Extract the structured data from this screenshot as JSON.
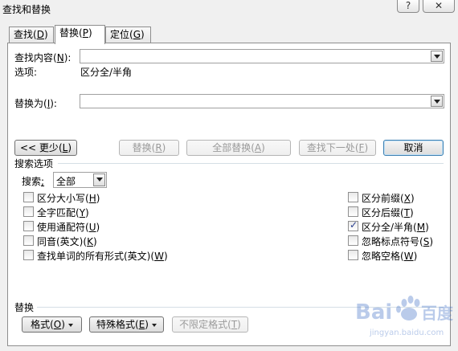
{
  "window": {
    "title": "查找和替换",
    "help_label": "?",
    "close_label": "✕"
  },
  "tabs": [
    {
      "label": "查找",
      "key": "D",
      "active": false
    },
    {
      "label": "替换",
      "key": "P",
      "active": true
    },
    {
      "label": "定位",
      "key": "G",
      "active": false
    }
  ],
  "find": {
    "label": "查找内容",
    "key": "N",
    "value": ""
  },
  "options": {
    "label": "选项:",
    "value": "区分全/半角"
  },
  "replace": {
    "label": "替换为",
    "key": "I",
    "value": ""
  },
  "buttons": {
    "less": {
      "label": "<< 更少",
      "key": "L"
    },
    "replace": {
      "label": "替换",
      "key": "R"
    },
    "replace_all": {
      "label": "全部替换",
      "key": "A"
    },
    "find_next": {
      "label": "查找下一处",
      "key": "F"
    },
    "cancel": {
      "label": "取消"
    }
  },
  "search_options": {
    "heading": "搜索选项",
    "search_label": "搜索",
    "search_key": ";",
    "search_value": "全部"
  },
  "left_checkboxes": [
    {
      "label": "区分大小写",
      "key": "H",
      "checked": false
    },
    {
      "label": "全字匹配",
      "key": "Y",
      "checked": false
    },
    {
      "label": "使用通配符",
      "key": "U",
      "checked": false
    },
    {
      "label": "同音(英文)",
      "key": "K",
      "checked": false
    },
    {
      "label": "查找单词的所有形式(英文)",
      "key": "W",
      "checked": false
    }
  ],
  "right_checkboxes": [
    {
      "label": "区分前缀",
      "key": "X",
      "checked": false
    },
    {
      "label": "区分后缀",
      "key": "T",
      "checked": false
    },
    {
      "label": "区分全/半角",
      "key": "M",
      "checked": true
    },
    {
      "label": "忽略标点符号",
      "key": "S",
      "checked": false
    },
    {
      "label": "忽略空格",
      "key": "W",
      "checked": false
    }
  ],
  "replace_section": {
    "heading": "替换",
    "format": {
      "label": "格式",
      "key": "O"
    },
    "special": {
      "label": "特殊格式",
      "key": "E"
    },
    "no_format": {
      "label": "不限定格式",
      "key": "T"
    }
  },
  "watermark": {
    "text": "Bai",
    "text2": "百度",
    "sub": "jingyan.baidu.com"
  }
}
